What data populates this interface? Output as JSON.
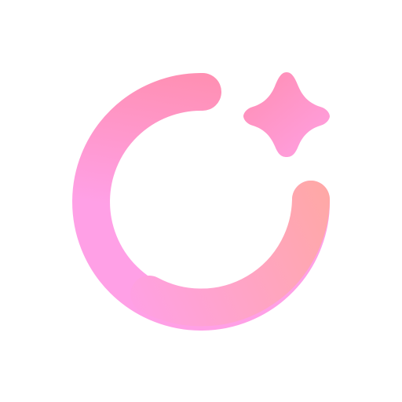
{
  "logo": {
    "name": "open-ring-with-sparkle",
    "colors": {
      "background": "#ffffff",
      "ring_gradient_start": "#ff8fb1",
      "ring_gradient_mid": "#ffa0e6",
      "ring_gradient_end": "#ffa8a6",
      "sparkle_gradient_start": "#ff8fb5",
      "sparkle_gradient_end": "#ff9fe0"
    }
  }
}
